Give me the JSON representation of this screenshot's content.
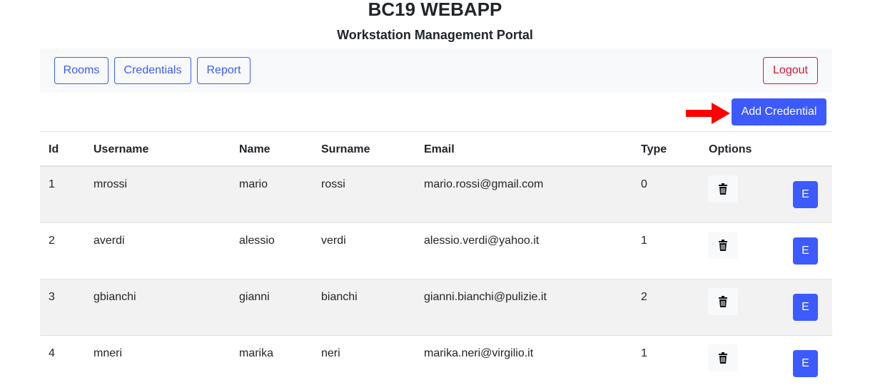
{
  "header": {
    "title": "BC19 WEBAPP",
    "subtitle": "Workstation Management Portal"
  },
  "nav": {
    "items": [
      {
        "label": "Rooms"
      },
      {
        "label": "Credentials"
      },
      {
        "label": "Report"
      }
    ],
    "logout_label": "Logout"
  },
  "actions": {
    "add_credential_label": "Add Credential"
  },
  "table": {
    "columns": [
      "Id",
      "Username",
      "Name",
      "Surname",
      "Email",
      "Type",
      "Options"
    ],
    "rows": [
      {
        "id": "1",
        "username": "mrossi",
        "name": "mario",
        "surname": "rossi",
        "email": "mario.rossi@gmail.com",
        "type": "0"
      },
      {
        "id": "2",
        "username": "averdi",
        "name": "alessio",
        "surname": "verdi",
        "email": "alessio.verdi@yahoo.it",
        "type": "1"
      },
      {
        "id": "3",
        "username": "gbianchi",
        "name": "gianni",
        "surname": "bianchi",
        "email": "gianni.bianchi@pulizie.it",
        "type": "2"
      },
      {
        "id": "4",
        "username": "mneri",
        "name": "marika",
        "surname": "neri",
        "email": "marika.neri@virgilio.it",
        "type": "1"
      }
    ],
    "edit_label": "E",
    "delete_icon": "trash-icon"
  },
  "colors": {
    "primary": "#3d5afe",
    "danger": "#dc143c",
    "annotation_arrow": "#ff0000",
    "stripe": "#f2f2f2"
  }
}
